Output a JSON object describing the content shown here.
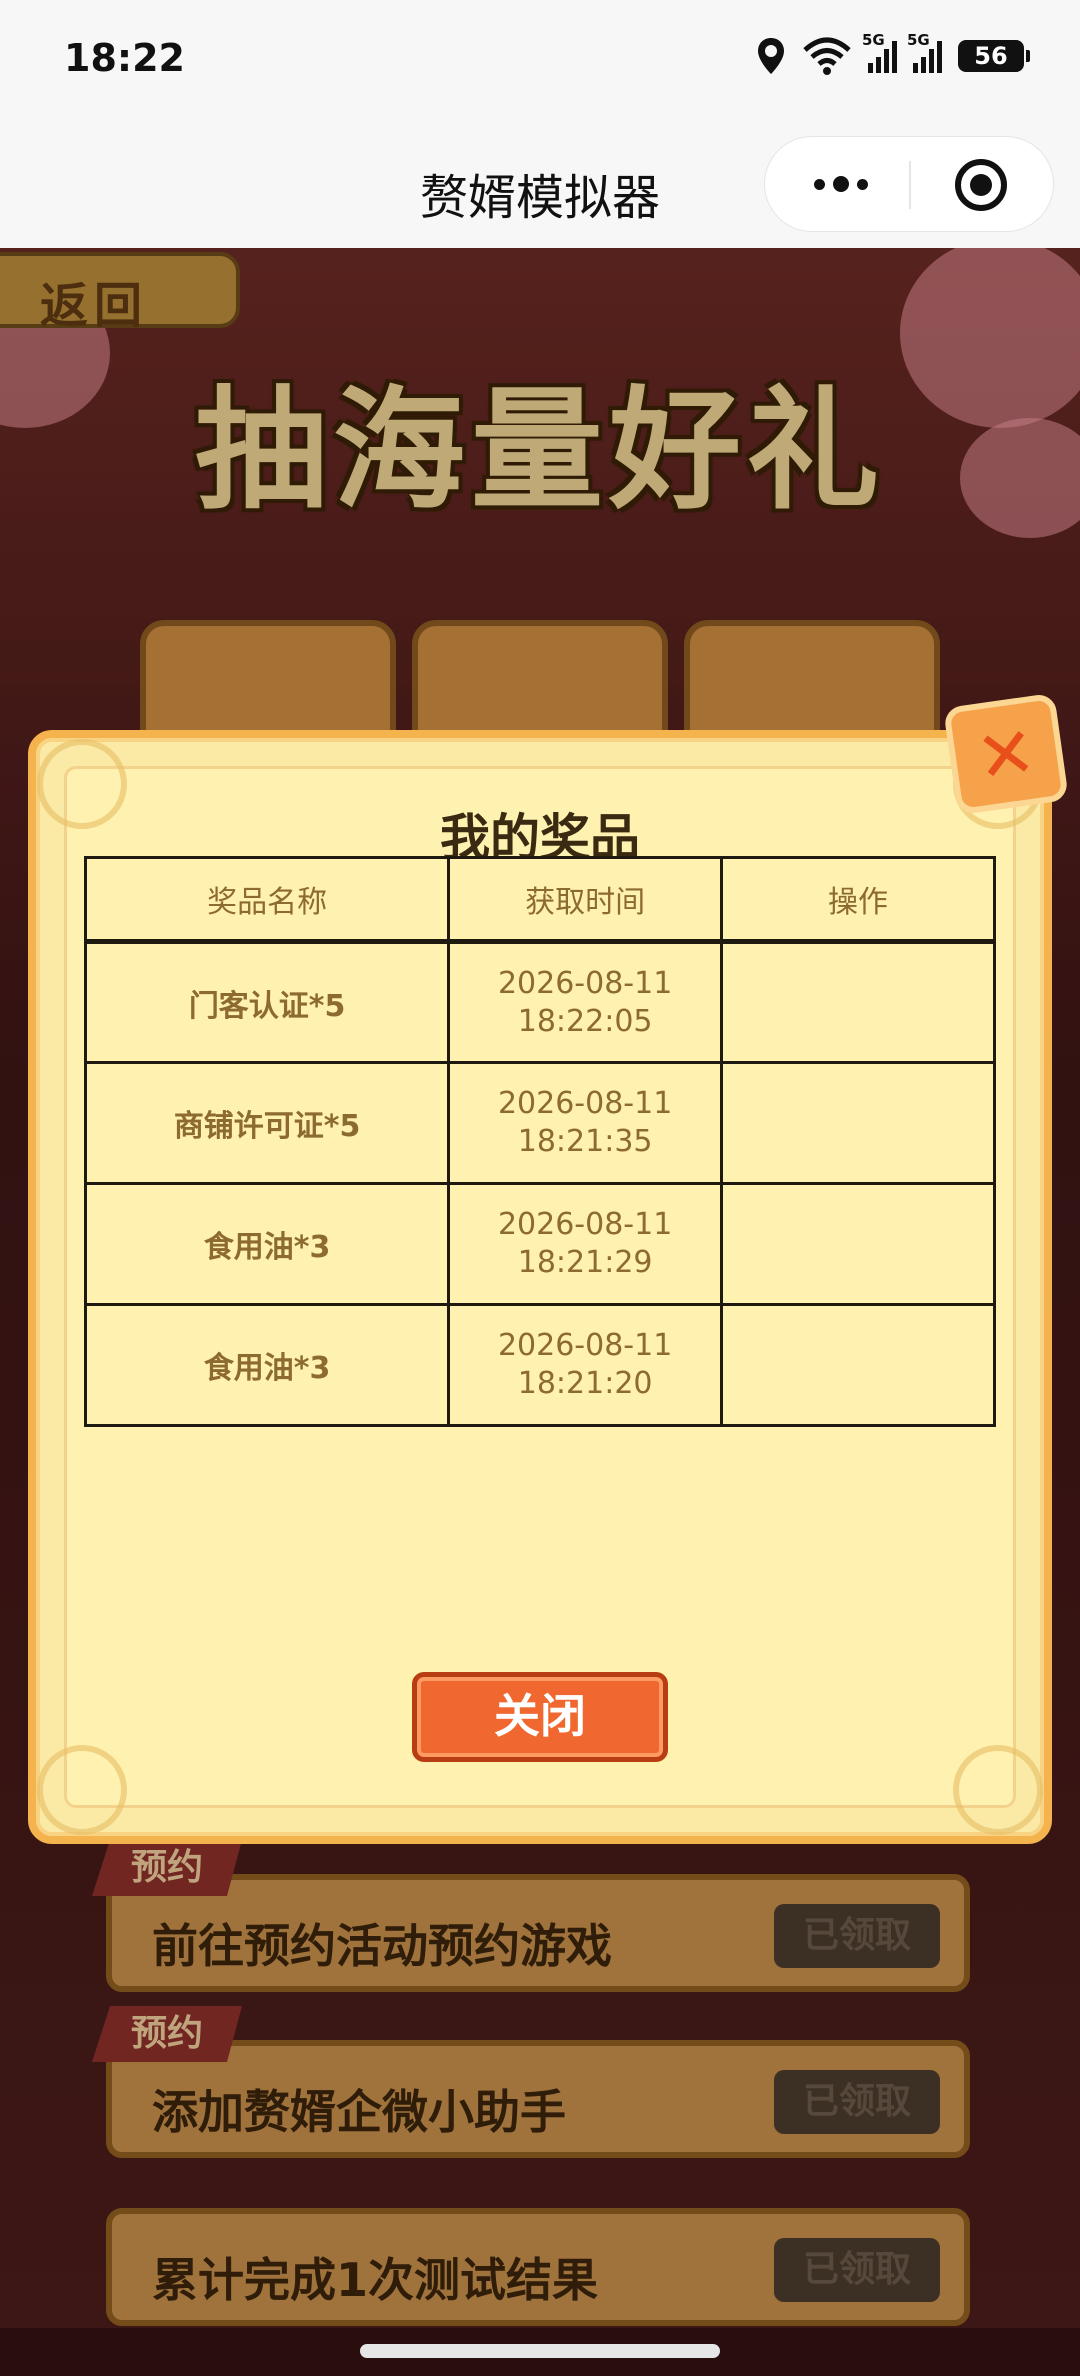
{
  "status_bar": {
    "time": "18:22",
    "network_1": "5G",
    "network_2": "5G",
    "battery": "56",
    "icons": [
      "location-icon",
      "wifi-icon",
      "signal-icon",
      "battery-icon"
    ]
  },
  "nav": {
    "title": "赘婿模拟器",
    "more_icon": "more-icon",
    "close_icon": "target-close-icon"
  },
  "background": {
    "back_label": "返回",
    "banner_title": "抽海量好礼",
    "tasks": [
      {
        "badge": "预约",
        "text": "前往预约活动预约游戏",
        "button": "已领取"
      },
      {
        "badge": "预约",
        "text": "添加赘婿企微小助手",
        "button": "已领取"
      },
      {
        "badge": "",
        "text": "累计完成1次测试结果",
        "button": "已领取"
      }
    ]
  },
  "modal": {
    "title": "我的奖品",
    "columns": [
      "奖品名称",
      "获取时间",
      "操作"
    ],
    "rows": [
      {
        "name": "门客认证*5",
        "date": "2026-08-11",
        "time": "18:22:05",
        "action": ""
      },
      {
        "name": "商铺许可证*5",
        "date": "2026-08-11",
        "time": "18:21:35",
        "action": ""
      },
      {
        "name": "食用油*3",
        "date": "2026-08-11",
        "time": "18:21:29",
        "action": ""
      },
      {
        "name": "食用油*3",
        "date": "2026-08-11",
        "time": "18:21:20",
        "action": ""
      }
    ],
    "close_label": "关闭",
    "close_icon": "close-x-icon"
  },
  "colors": {
    "accent": "#f0672f",
    "modal_bg": "#fff1b0",
    "table_text": "#8c6a30",
    "title_text": "#3a2a12"
  }
}
